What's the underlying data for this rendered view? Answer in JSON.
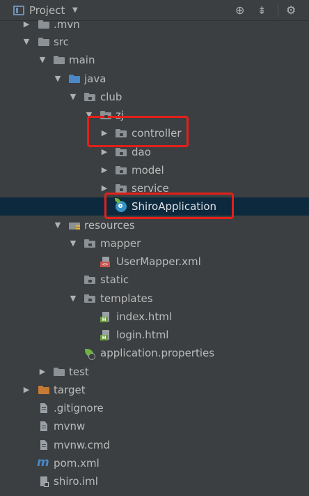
{
  "header": {
    "title": "Project",
    "caret": "▼",
    "locate_icon": "crosshair-icon",
    "collapse_icon": "collapse-all-icon",
    "settings_icon": "gear-icon"
  },
  "tree": [
    {
      "label": ".mvn",
      "arrow": "▶",
      "icon": "folder-grey"
    },
    {
      "label": "src",
      "arrow": "▼",
      "icon": "folder-grey"
    },
    {
      "label": "main",
      "arrow": "▼",
      "icon": "folder-grey"
    },
    {
      "label": "java",
      "arrow": "▼",
      "icon": "folder-blue"
    },
    {
      "label": "club",
      "arrow": "▼",
      "icon": "package"
    },
    {
      "label": "zj",
      "arrow": "▼",
      "icon": "package"
    },
    {
      "label": "controller",
      "arrow": "▶",
      "icon": "package"
    },
    {
      "label": "dao",
      "arrow": "▶",
      "icon": "package"
    },
    {
      "label": "model",
      "arrow": "▶",
      "icon": "package"
    },
    {
      "label": "service",
      "arrow": "▶",
      "icon": "package"
    },
    {
      "label": "ShiroApplication",
      "arrow": "",
      "icon": "spring-app"
    },
    {
      "label": "resources",
      "arrow": "▼",
      "icon": "resources-folder"
    },
    {
      "label": "mapper",
      "arrow": "▼",
      "icon": "folder-grey"
    },
    {
      "label": "UserMapper.xml",
      "arrow": "",
      "icon": "xml-file"
    },
    {
      "label": "static",
      "arrow": "",
      "icon": "folder-grey"
    },
    {
      "label": "templates",
      "arrow": "▼",
      "icon": "folder-grey"
    },
    {
      "label": "index.html",
      "arrow": "",
      "icon": "html-file"
    },
    {
      "label": "login.html",
      "arrow": "",
      "icon": "html-file"
    },
    {
      "label": "application.properties",
      "arrow": "",
      "icon": "spring-properties"
    },
    {
      "label": "test",
      "arrow": "▶",
      "icon": "folder-grey"
    },
    {
      "label": "target",
      "arrow": "▶",
      "icon": "folder-orange"
    },
    {
      "label": ".gitignore",
      "arrow": "",
      "icon": "text-file"
    },
    {
      "label": "mvnw",
      "arrow": "",
      "icon": "text-file"
    },
    {
      "label": "mvnw.cmd",
      "arrow": "",
      "icon": "text-file"
    },
    {
      "label": "pom.xml",
      "arrow": "",
      "icon": "maven-file"
    },
    {
      "label": "shiro.iml",
      "arrow": "",
      "icon": "iml-file"
    }
  ],
  "badges": {
    "xml": "<>",
    "html": "H"
  },
  "colors": {
    "background": "#3c3f41",
    "selection": "#0d293e",
    "highlight_box": "#e3201a",
    "text": "#bbbbbb",
    "source_folder": "#4a88c7",
    "excluded_folder": "#c57b34"
  },
  "selected_item": "ShiroApplication"
}
